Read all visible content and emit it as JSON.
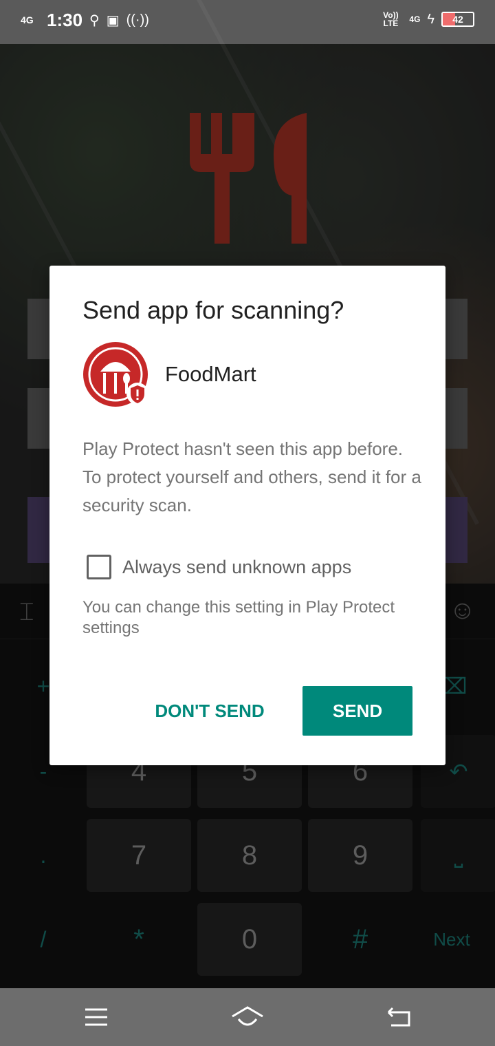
{
  "status_bar": {
    "network_type": "4G",
    "time": "1:30",
    "volte": "Vo)) LTE",
    "network_right": "4G",
    "battery": "42",
    "battery_level": 0.42
  },
  "dialog": {
    "title": "Send app for scanning?",
    "app_name": "FoodMart",
    "body": "Play Protect hasn't seen this app before. To protect yourself and others, send it for a security scan.",
    "checkbox_label": "Always send unknown apps",
    "checkbox_checked": false,
    "note": "You can change this setting in Play Protect settings",
    "dont_send_label": "DON'T SEND",
    "send_label": "SEND",
    "accent_color": "#00897b"
  },
  "keyboard": {
    "keys": {
      "k4": "4",
      "k5": "5",
      "k6": "6",
      "k7": "7",
      "k8": "8",
      "k9": "9",
      "star": "*",
      "k0": "0",
      "hash": "#"
    },
    "side": {
      "plus": "+",
      "minus": "-",
      "dot": ".",
      "slash": "/",
      "next": "Next"
    }
  },
  "icons": [
    "signal-icon",
    "usb-icon",
    "hotspot-icon",
    "charging-icon",
    "menu-icon",
    "home-icon",
    "back-icon",
    "emoji-icon",
    "backspace-icon",
    "cursor-icon"
  ]
}
